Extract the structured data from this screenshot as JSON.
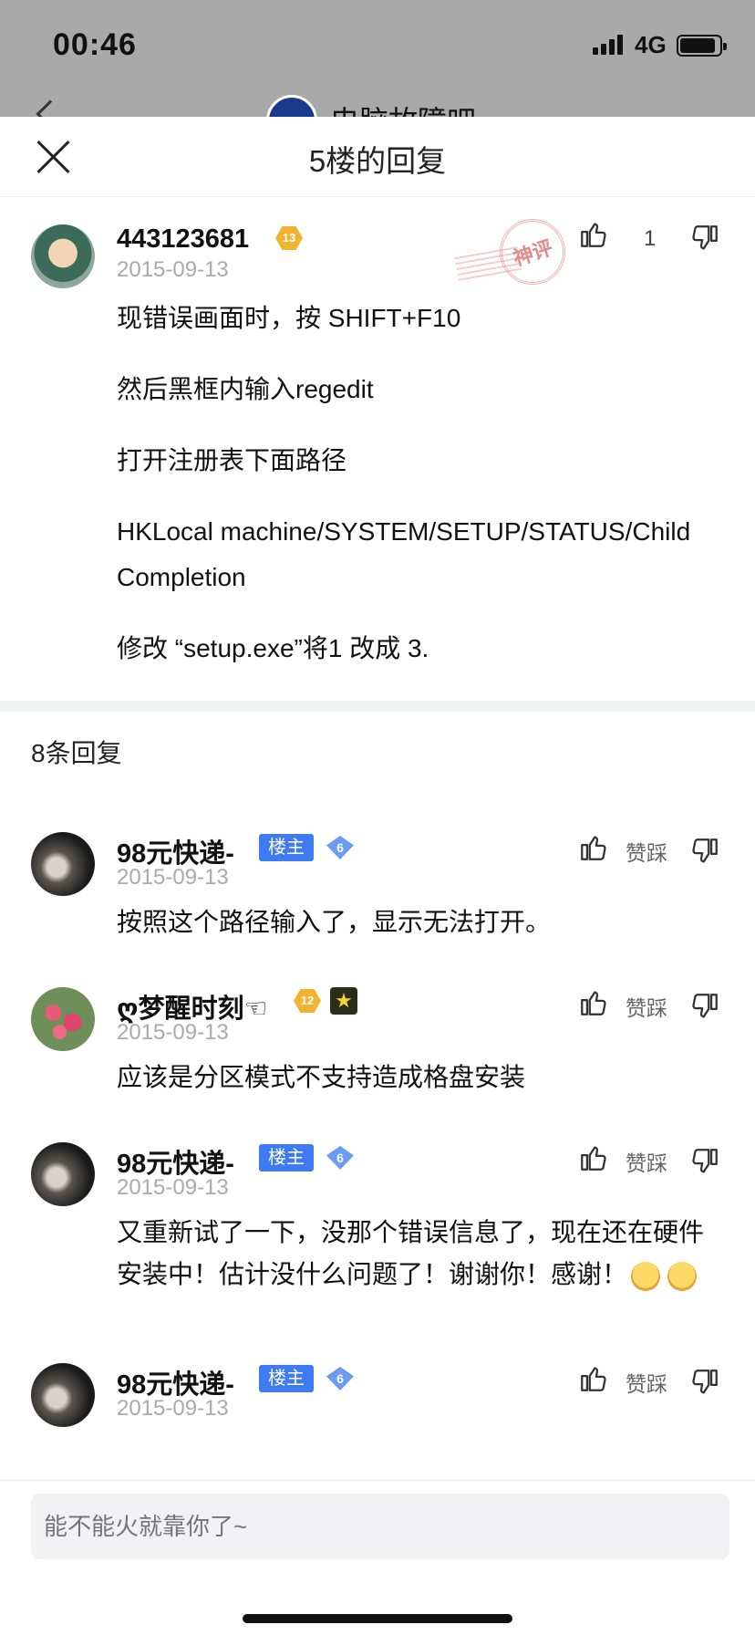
{
  "status_bar": {
    "time": "00:46",
    "network": "4G"
  },
  "background_page": {
    "title": "电脑故障吧"
  },
  "sheet": {
    "title": "5楼的回复"
  },
  "main_post": {
    "username": "443123681",
    "level": "13",
    "date": "2015-09-13",
    "stamp_text": "神评",
    "like_count": "1",
    "paragraphs": [
      "现错误画面时，按 SHIFT+F10",
      "然后黑框内输入regedit",
      "打开注册表下面路径",
      "HKLocal machine/SYSTEM/SETUP/STATUS/ChildCompletion",
      "修改 “setup.exe”将1 改成 3."
    ]
  },
  "reply_count_label": "8条回复",
  "zancai_label": "赞踩",
  "louzhu_label": "楼主",
  "replies": [
    {
      "username": "98元快递-",
      "level": "6",
      "date": "2015-09-13",
      "text": "按照这个路径输入了，显示无法打开。"
    },
    {
      "username": "ღ梦醒时刻☜",
      "level": "12",
      "date": "2015-09-13",
      "text": "应该是分区模式不支持造成格盘安装"
    },
    {
      "username": "98元快递-",
      "level": "6",
      "date": "2015-09-13",
      "text": "又重新试了一下，没那个错误信息了，现在还在硬件安装中！估计没什么问题了！谢谢你！感谢！"
    },
    {
      "username": "98元快递-",
      "level": "6",
      "date": "2015-09-13",
      "text": ""
    }
  ],
  "footer": {
    "placeholder": "能不能火就靠你了~"
  }
}
